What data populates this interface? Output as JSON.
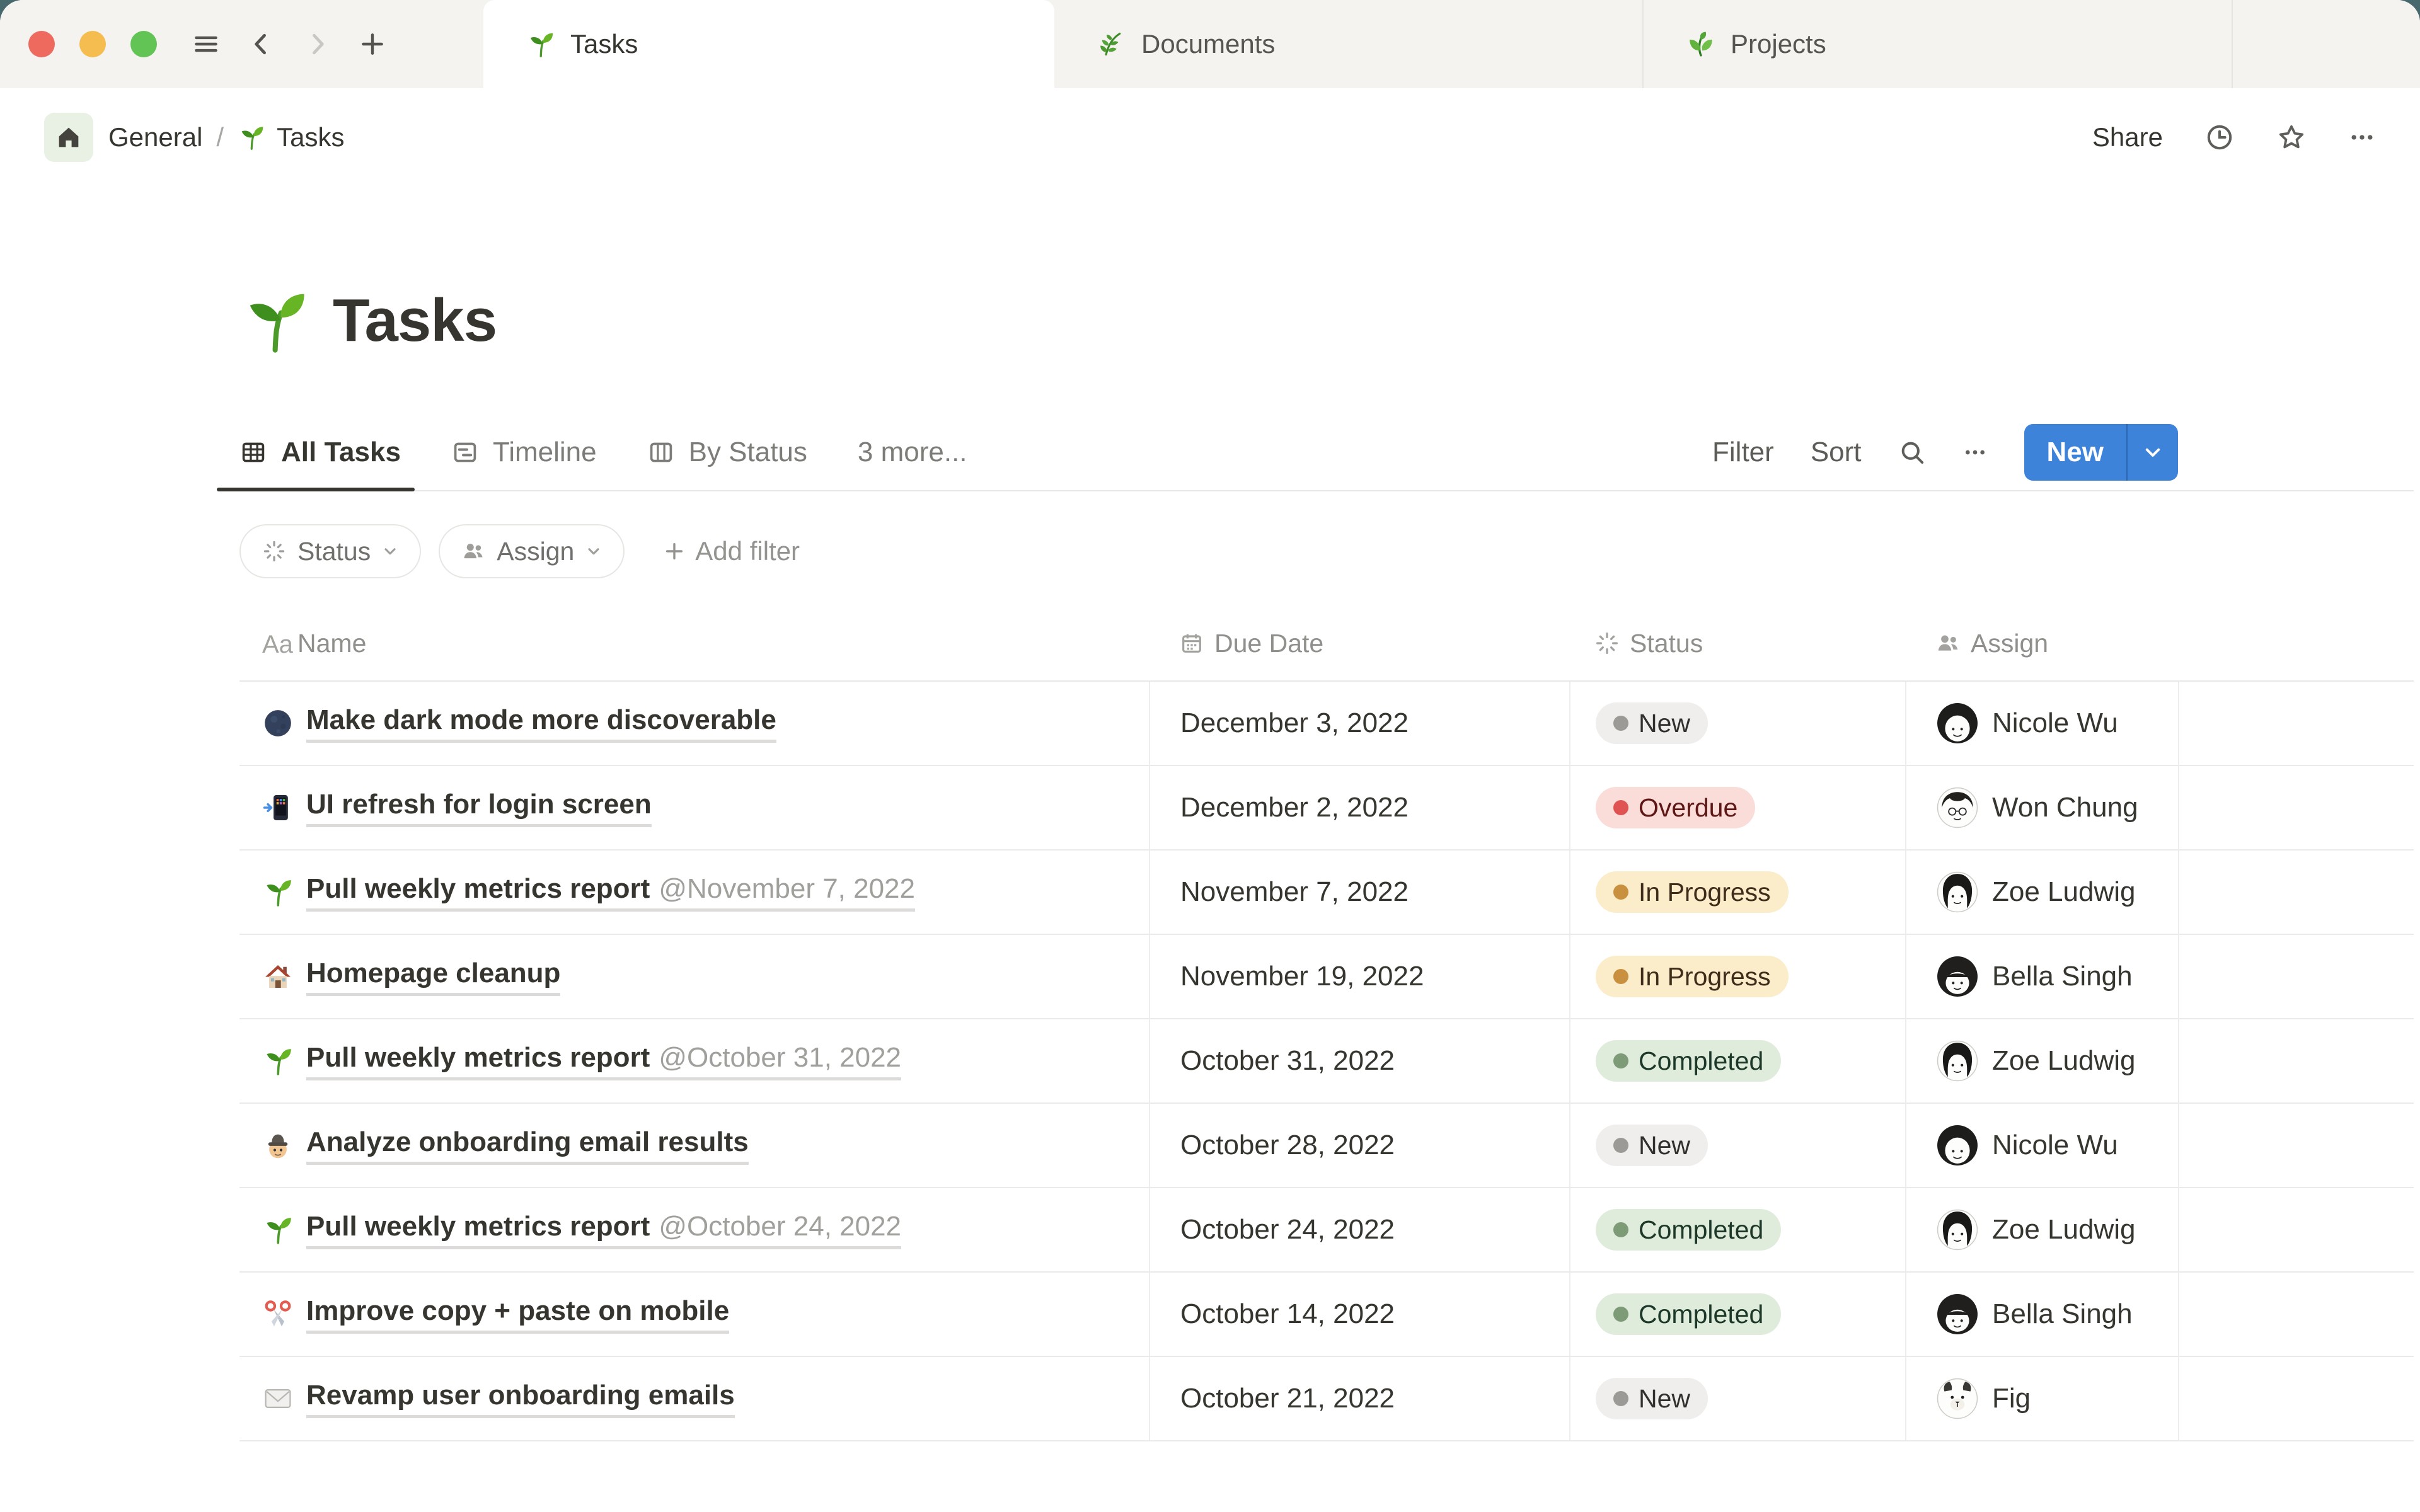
{
  "chrome": {
    "traffic_lights": [
      "close",
      "minimize",
      "zoom"
    ],
    "menu_icon": "menu",
    "back_icon": "chevron-left",
    "forward_icon": "chevron-right",
    "new_tab_icon": "plus",
    "search_icon": "search",
    "more_icon": "dots",
    "new_caret_icon": "chevron-down",
    "chip_caret_icon": "chevron-down",
    "add_icon": "plus"
  },
  "tab_bar": {
    "tabs": [
      {
        "icon": "seedling",
        "label": "Tasks",
        "active": true
      },
      {
        "icon": "herb",
        "label": "Documents",
        "active": false
      },
      {
        "icon": "lettuce",
        "label": "Projects",
        "active": false
      }
    ]
  },
  "breadcrumb": {
    "home_icon": "home",
    "workspace": "General",
    "separator": "/",
    "page_icon": "seedling",
    "page": "Tasks",
    "share_label": "Share",
    "history_icon": "clock",
    "favorite_icon": "star",
    "more_icon": "dots"
  },
  "page": {
    "icon": "seedling",
    "title": "Tasks"
  },
  "views": {
    "tabs": [
      {
        "icon": "table",
        "label": "All Tasks",
        "active": true
      },
      {
        "icon": "timeline",
        "label": "Timeline",
        "active": false
      },
      {
        "icon": "board",
        "label": "By Status",
        "active": false
      }
    ],
    "more_label": "3 more...",
    "filter_label": "Filter",
    "sort_label": "Sort",
    "new_label": "New"
  },
  "filters": {
    "chips": [
      {
        "icon": "burst",
        "label": "Status"
      },
      {
        "icon": "people",
        "label": "Assign"
      }
    ],
    "add_label": "Add filter"
  },
  "table": {
    "columns": [
      {
        "icon": "aa",
        "label": "Name"
      },
      {
        "icon": "calendar",
        "label": "Due Date"
      },
      {
        "icon": "burst",
        "label": "Status"
      },
      {
        "icon": "people",
        "label": "Assign"
      }
    ],
    "rows": [
      {
        "icon": "moon",
        "name": "Make dark mode more discoverable",
        "mention": "",
        "due": "December 3, 2022",
        "status": "New",
        "status_color": "gray",
        "assignee": "Nicole Wu",
        "avatar": "nicole"
      },
      {
        "icon": "phone",
        "name": "UI refresh for login screen",
        "mention": "",
        "due": "December 2, 2022",
        "status": "Overdue",
        "status_color": "red",
        "assignee": "Won Chung",
        "avatar": "won"
      },
      {
        "icon": "seedling",
        "name": "Pull weekly metrics report",
        "mention": "@November 7, 2022",
        "due": "November 7, 2022",
        "status": "In Progress",
        "status_color": "yellow",
        "assignee": "Zoe Ludwig",
        "avatar": "zoe"
      },
      {
        "icon": "house",
        "name": "Homepage cleanup",
        "mention": "",
        "due": "November 19, 2022",
        "status": "In Progress",
        "status_color": "yellow",
        "assignee": "Bella Singh",
        "avatar": "bella"
      },
      {
        "icon": "seedling",
        "name": "Pull weekly metrics report",
        "mention": "@October 31, 2022",
        "due": "October 31, 2022",
        "status": "Completed",
        "status_color": "green",
        "assignee": "Zoe Ludwig",
        "avatar": "zoe"
      },
      {
        "icon": "detective",
        "name": "Analyze onboarding email results",
        "mention": "",
        "due": "October 28, 2022",
        "status": "New",
        "status_color": "gray",
        "assignee": "Nicole Wu",
        "avatar": "nicole"
      },
      {
        "icon": "seedling",
        "name": "Pull weekly metrics report",
        "mention": "@October 24, 2022",
        "due": "October 24, 2022",
        "status": "Completed",
        "status_color": "green",
        "assignee": "Zoe Ludwig",
        "avatar": "zoe"
      },
      {
        "icon": "scissors",
        "name": "Improve copy + paste on mobile",
        "mention": "",
        "due": "October 14, 2022",
        "status": "Completed",
        "status_color": "green",
        "assignee": "Bella Singh",
        "avatar": "bella"
      },
      {
        "icon": "envelope",
        "name": "Revamp user onboarding emails",
        "mention": "",
        "due": "October 21, 2022",
        "status": "New",
        "status_color": "gray",
        "assignee": "Fig",
        "avatar": "fig"
      }
    ]
  },
  "colors": {
    "accent_blue": "#3d83da",
    "status_gray_bg": "#efeeec",
    "status_gray_dot": "#9b9a97",
    "status_red_bg": "#fadcd9",
    "status_red_dot": "#df5452",
    "status_yellow_bg": "#fbecca",
    "status_yellow_dot": "#c9913f",
    "status_green_bg": "#e0ecdb",
    "status_green_dot": "#7d9b76",
    "traffic_red": "#ee6a5f",
    "traffic_yellow": "#f5bd4f",
    "traffic_green": "#61c454"
  }
}
